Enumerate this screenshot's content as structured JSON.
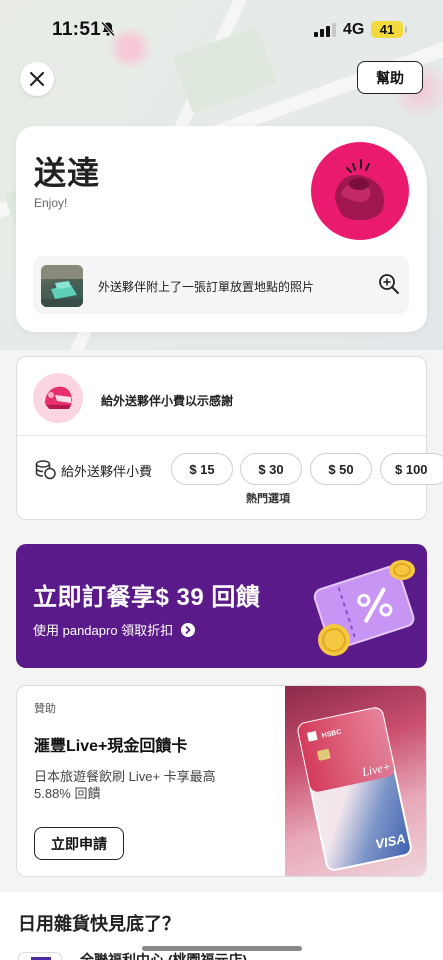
{
  "status_bar": {
    "time": "11:51",
    "network": "4G",
    "battery": "41"
  },
  "header": {
    "help_label": "幫助"
  },
  "delivery": {
    "title": "送達",
    "subtitle": "Enjoy!",
    "photo_text": "外送夥伴附上了一張訂單放置地點的照片"
  },
  "tip": {
    "thanks_text": "給外送夥伴小費以示感謝",
    "label": "給外送夥伴小費",
    "options": [
      "$ 15",
      "$ 30",
      "$ 50",
      "$ 100"
    ],
    "popular_label": "熱門選項"
  },
  "promo": {
    "title": "立即訂餐享$ 39 回饋",
    "subtitle": "使用 pandapro 領取折扣",
    "colors": {
      "background": "#5b1a8a",
      "coin": "#f5c842"
    }
  },
  "ad": {
    "tag": "贊助",
    "title": "滙豐Live+現金回饋卡",
    "description": "日本旅遊餐飲刷 Live+ 卡享最高 5.88% 回饋",
    "button_label": "立即申請",
    "card_brand": "HSBC",
    "card_live_text": "Live+",
    "card_network": "VISA"
  },
  "groceries": {
    "heading": "日用雜貨快見底了？",
    "store_name": "全聯福利中心 (桃園福元店)"
  },
  "colors": {
    "brand_pink": "#ea1b6f",
    "battery_yellow": "#f2d93d"
  }
}
